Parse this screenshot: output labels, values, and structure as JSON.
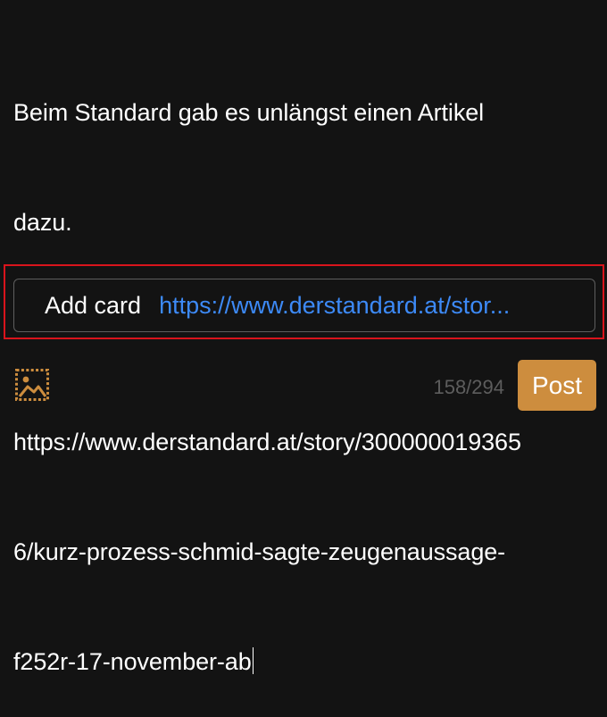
{
  "compose": {
    "lines": [
      "Beim Standard gab es unlängst einen Artikel",
      "dazu.",
      "",
      "https://www.derstandard.at/story/300000019365",
      "6/kurz-prozess-schmid-sagte-zeugenaussage-",
      "f252r-17-november-ab"
    ]
  },
  "card": {
    "label": "Add card",
    "url": "https://www.derstandard.at/stor..."
  },
  "footer": {
    "image_icon": "image-icon",
    "char_count": "158/294",
    "post_label": "Post"
  },
  "colors": {
    "background": "#131313",
    "accent": "#cd8d3e",
    "link": "#3d8af7",
    "highlight": "#d9141c",
    "muted": "#5d5d5d"
  }
}
